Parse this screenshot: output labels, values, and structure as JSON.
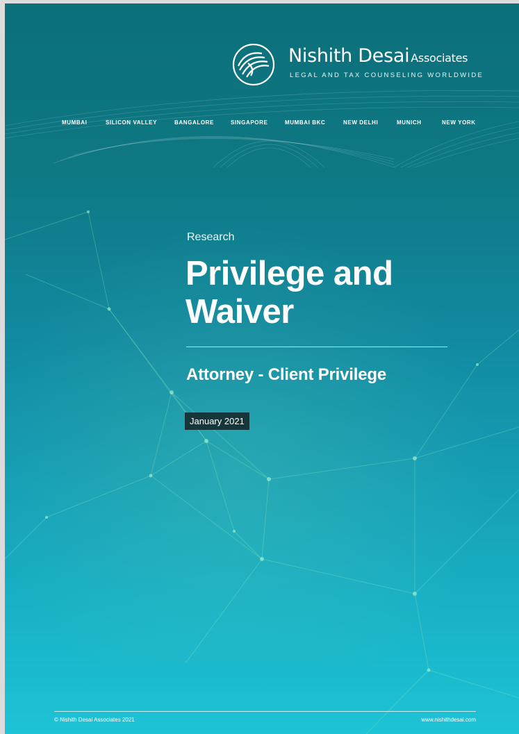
{
  "logo": {
    "name_main": "Nishith Desai",
    "name_sub": "Associates",
    "tagline": "LEGAL AND TAX COUNSELING WORLDWIDE",
    "mark_icon": "nda-swirl-logo-icon"
  },
  "offices": [
    "MUMBAI",
    "SILICON VALLEY",
    "BANGALORE",
    "SINGAPORE",
    "MUMBAI BKC",
    "NEW DELHI",
    "MUNICH",
    "NEW YORK"
  ],
  "document": {
    "category": "Research",
    "title": "Privilege and Waiver",
    "subtitle": "Attorney - Client Privilege",
    "date": "January 2021"
  },
  "footer": {
    "copyright": "© Nishith Desai Associates 2021",
    "website": "www.nishithdesai.com"
  },
  "colors": {
    "background_top": "#0c6f7a",
    "background_bottom": "#1ec3d6",
    "date_badge": "#15363b",
    "network_lines": "#8fe6b5"
  }
}
